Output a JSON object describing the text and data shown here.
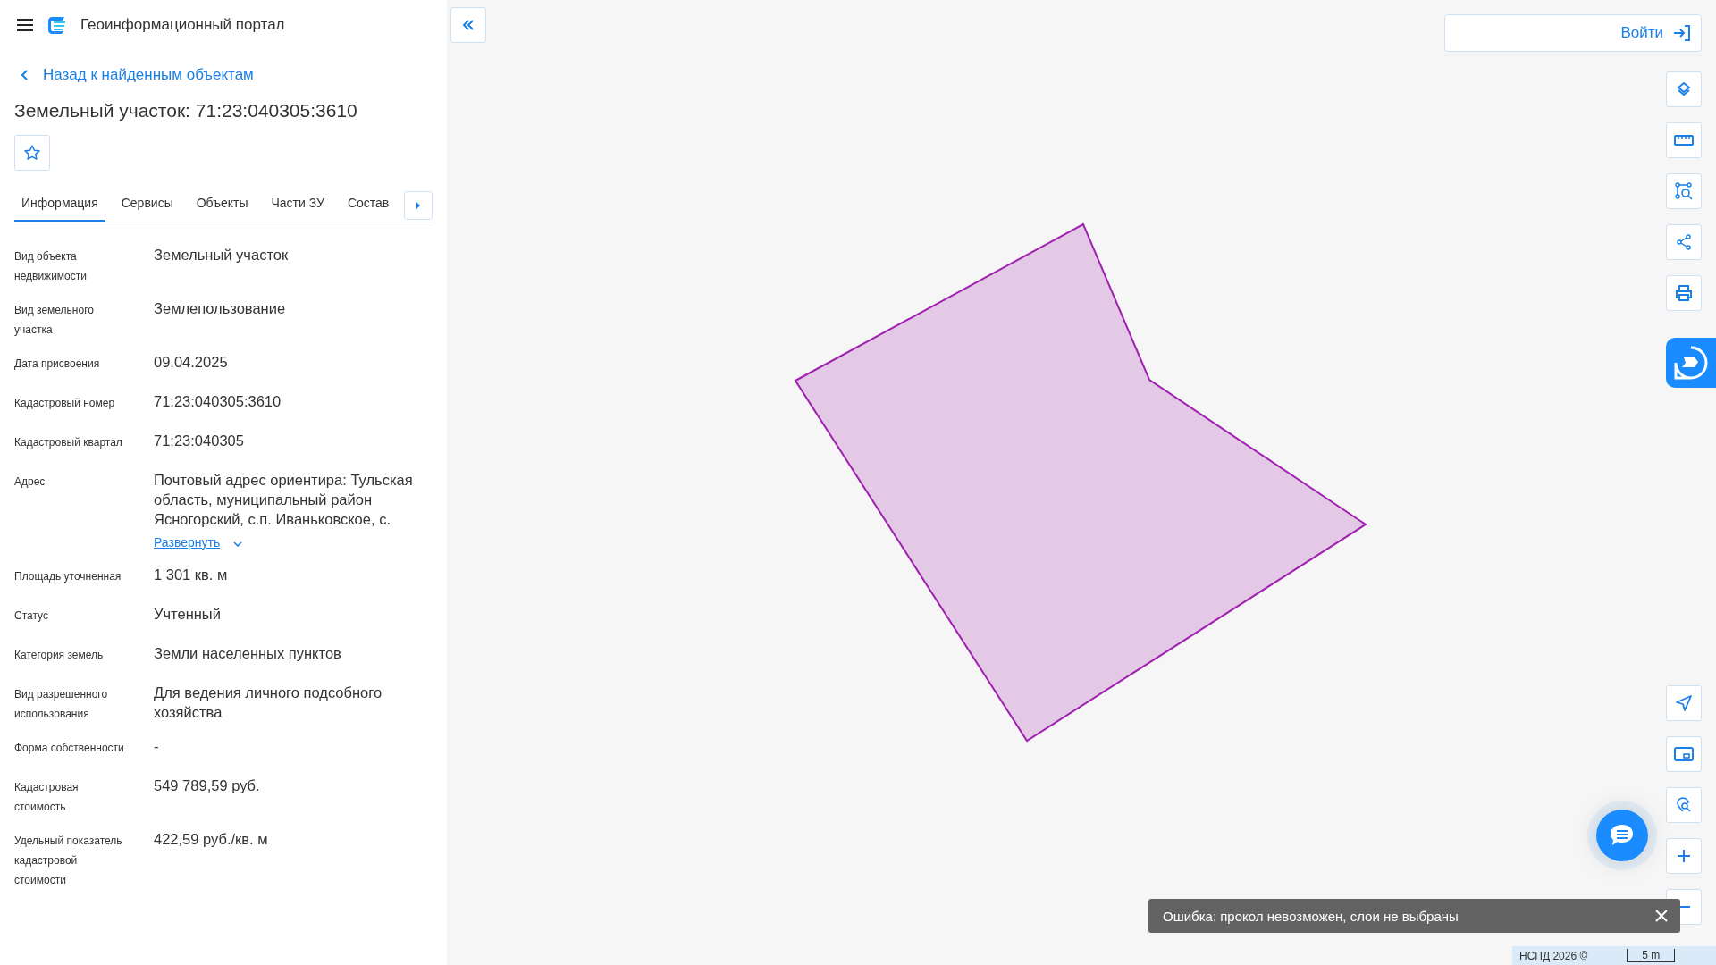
{
  "header": {
    "title": "Геоинформационный портал"
  },
  "back_link": "Назад к найденным объектам",
  "object_title": "Земельный участок: 71:23:040305:3610",
  "favorite": {
    "selected": false
  },
  "tabs": [
    {
      "label": "Информация",
      "selected": true
    },
    {
      "label": "Сервисы",
      "selected": false
    },
    {
      "label": "Объекты",
      "selected": false
    },
    {
      "label": "Части ЗУ",
      "selected": false
    },
    {
      "label": "Состав",
      "selected": false
    }
  ],
  "properties": [
    {
      "label": "Вид объекта недвижимости",
      "value": "Земельный участок"
    },
    {
      "label": "Вид земельного участка",
      "value": "Землепользование"
    },
    {
      "label": "Дата присвоения",
      "value": "09.04.2025"
    },
    {
      "label": "Кадастровый номер",
      "value": "71:23:040305:3610"
    },
    {
      "label": "Кадастровый квартал",
      "value": "71:23:040305"
    },
    {
      "label": "Адрес",
      "value": "Почтовый адрес ориентира: Тульская область, муниципальный район Ясногорский, с.п. Иваньковское, с.",
      "expand_link": "Развернуть"
    },
    {
      "label": "Площадь уточненная",
      "value": "1 301 кв. м"
    },
    {
      "label": "Статус",
      "value": "Учтенный"
    },
    {
      "label": "Категория земель",
      "value": "Земли населенных пунктов"
    },
    {
      "label": "Вид разрешенного использования",
      "value": "Для ведения личного подсобного хозяйства"
    },
    {
      "label": "Форма собственности",
      "value": "-"
    },
    {
      "label": "Кадастровая стоимость",
      "value": "549 789,59 руб."
    },
    {
      "label": "Удельный показатель кадастровой стоимости",
      "value": "422,59 руб./кв. м"
    }
  ],
  "login_button": "Войти",
  "snackbar": {
    "message": "Ошибка: прокол невозможен, слои не выбраны"
  },
  "footer": {
    "copyright": "НСПД 2026 ©",
    "scale": "5 m"
  }
}
